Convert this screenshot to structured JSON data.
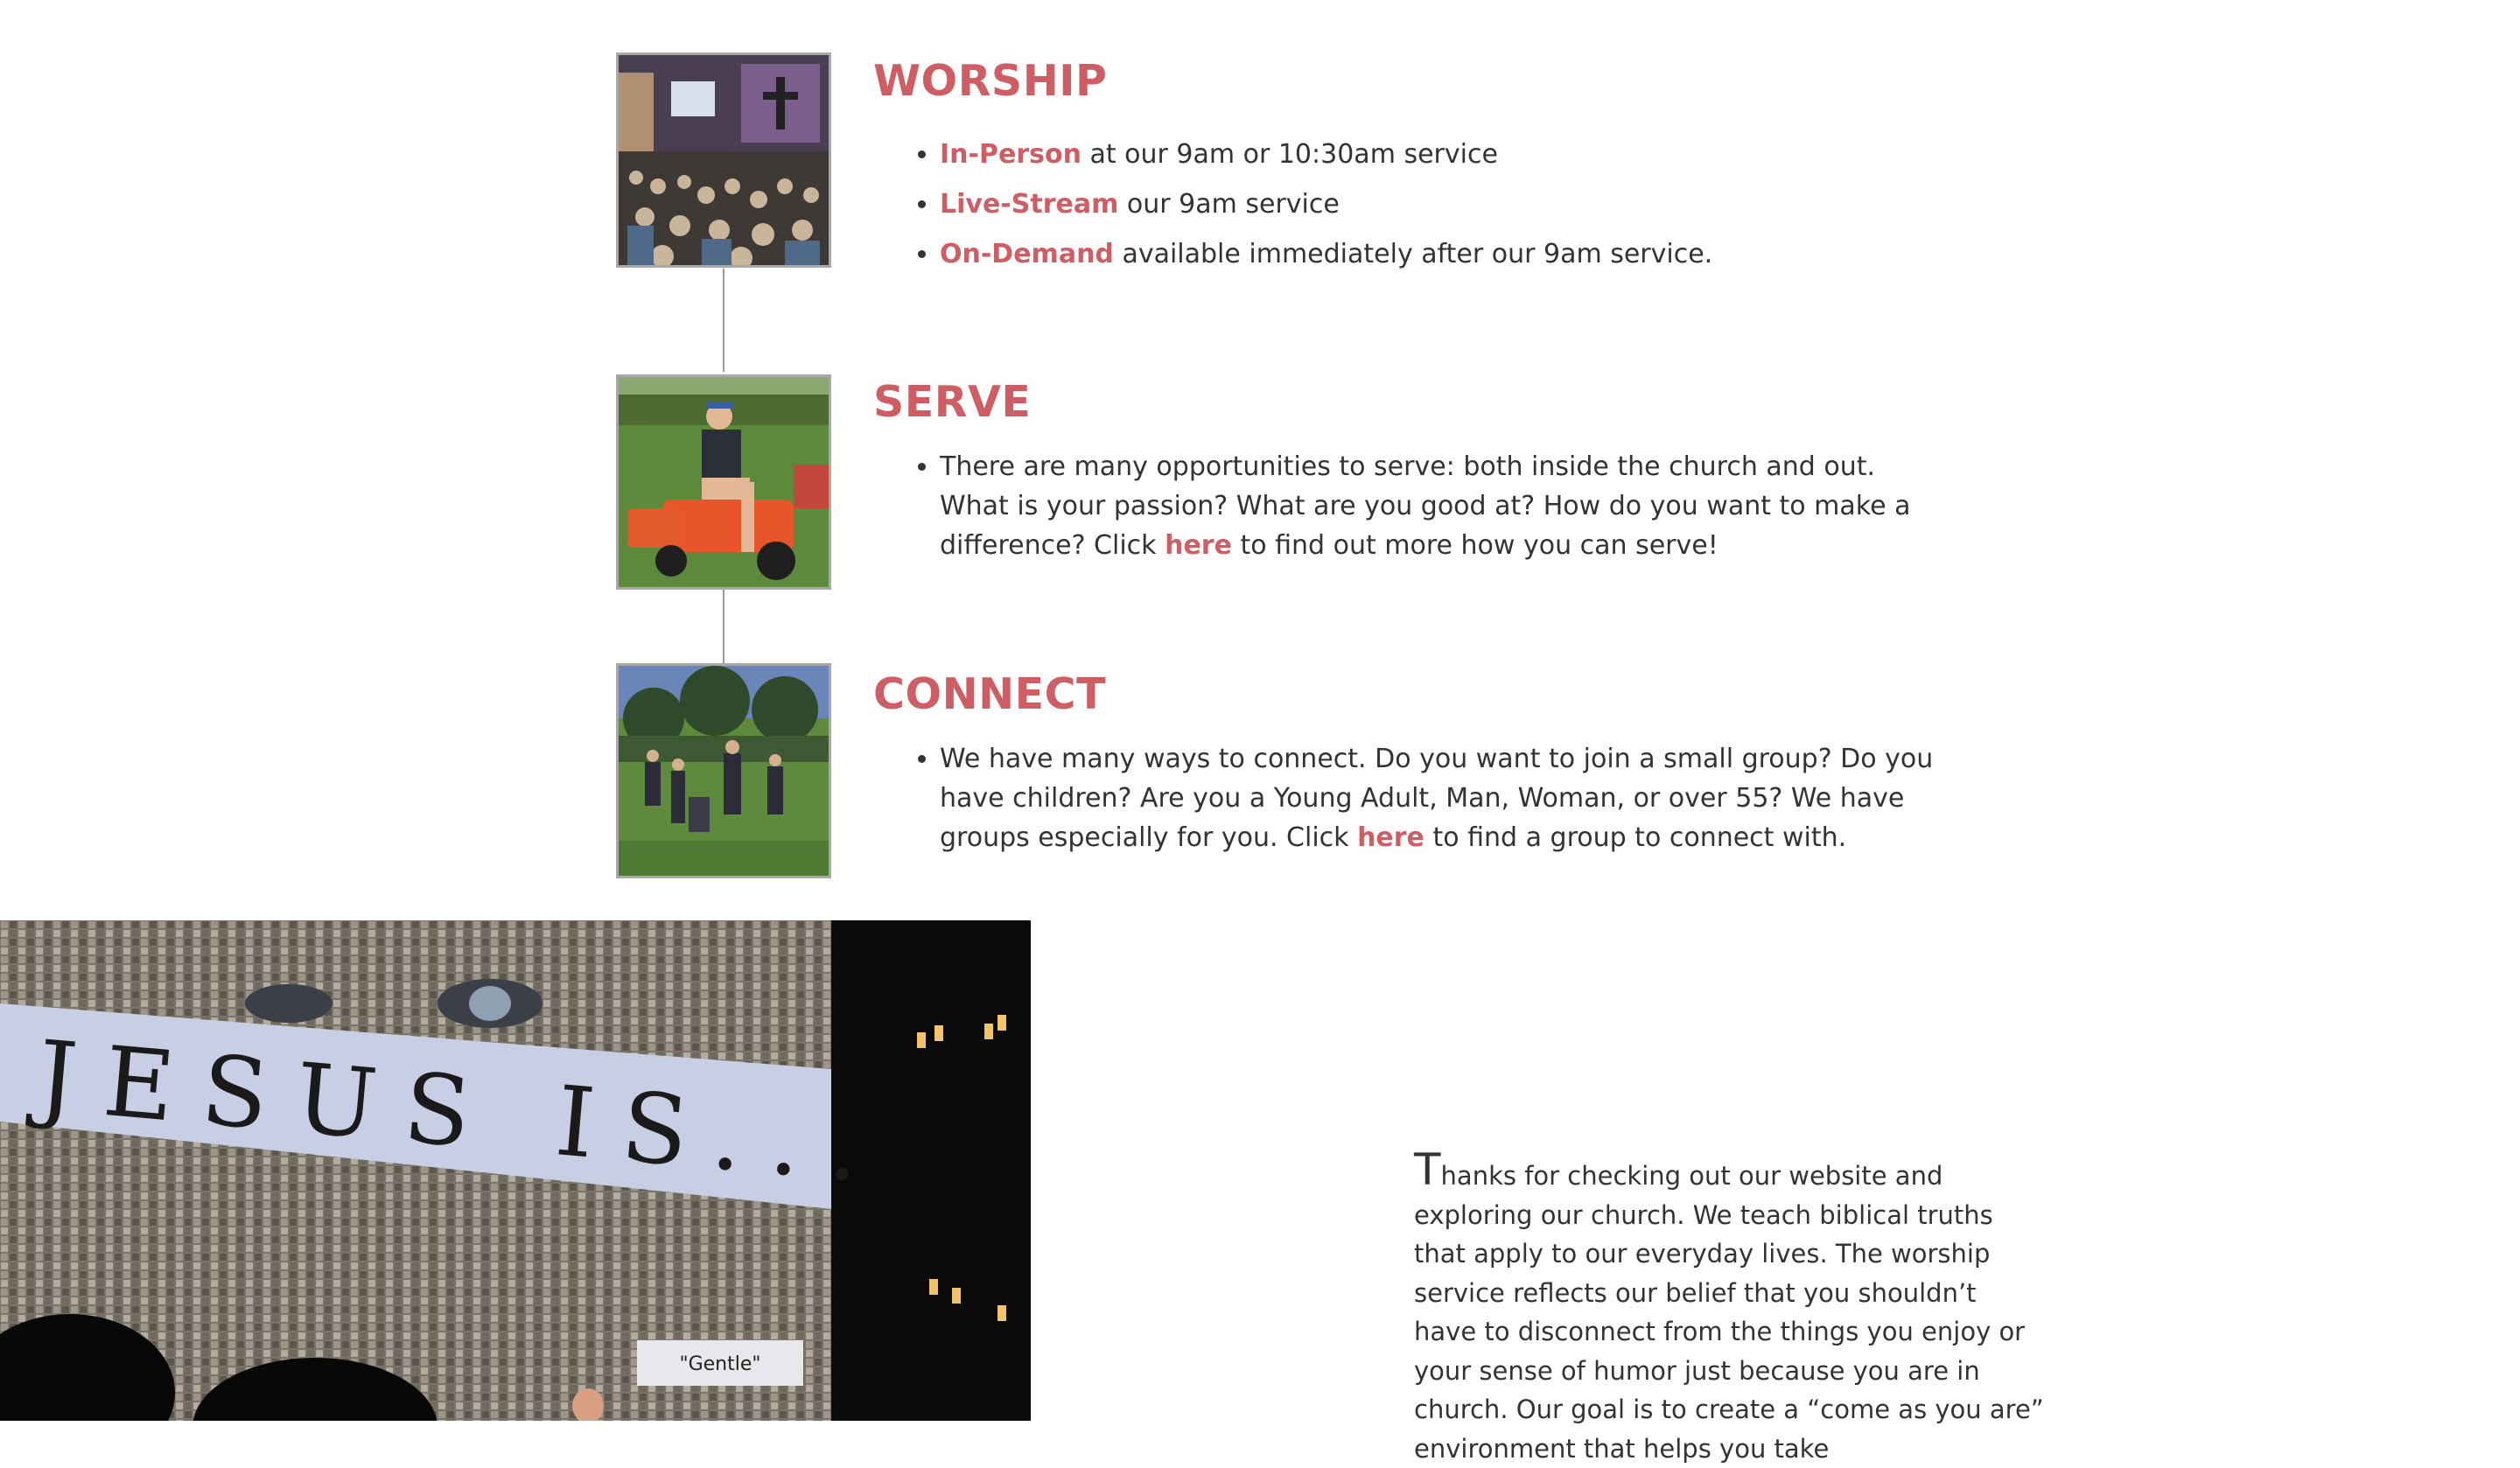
{
  "colors": {
    "accent": "#cf5e64",
    "text": "#333333",
    "line": "#9a9a9a"
  },
  "sections": [
    {
      "key": "worship",
      "heading": "WORSHIP",
      "image_alt": "worship service photo",
      "items": [
        {
          "link": "In-Person",
          "text": " at our 9am or 10:30am service"
        },
        {
          "link": "Live-Stream",
          "text": " our 9am service"
        },
        {
          "link": "On-Demand",
          "text": " available immediately after our 9am service."
        }
      ]
    },
    {
      "key": "serve",
      "heading": "SERVE",
      "image_alt": "man on a lawn tractor",
      "item": {
        "text_before": "There are many opportunities to serve: both inside the church and out.  What is your passion?  What are you good at? How do you want to make a difference? Click ",
        "link": "here",
        "text_after": " to find out more how you can serve!"
      }
    },
    {
      "key": "connect",
      "heading": "CONNECT",
      "image_alt": "outdoor gathering photo",
      "item": {
        "text_before": "We have many ways to connect.  Do you want to join a small group?  Do you have children? Are you a Young Adult, Man, Woman, or over 55?  We have groups especially for you. Click ",
        "link": "here",
        "text_after": " to find a group to connect with."
      }
    }
  ],
  "hero": {
    "screen_title": "JESUS IS...",
    "caption": "\"Gentle\""
  },
  "welcome": {
    "dropcap": "T",
    "text": "hanks for checking out our website and exploring our church. We teach biblical truths that apply to our everyday lives. The worship service reflects our belief that you shouldn’t have to disconnect from the things you enjoy or your sense of humor just because you are in church. Our goal is to create a “come as you are” environment that helps you take"
  }
}
